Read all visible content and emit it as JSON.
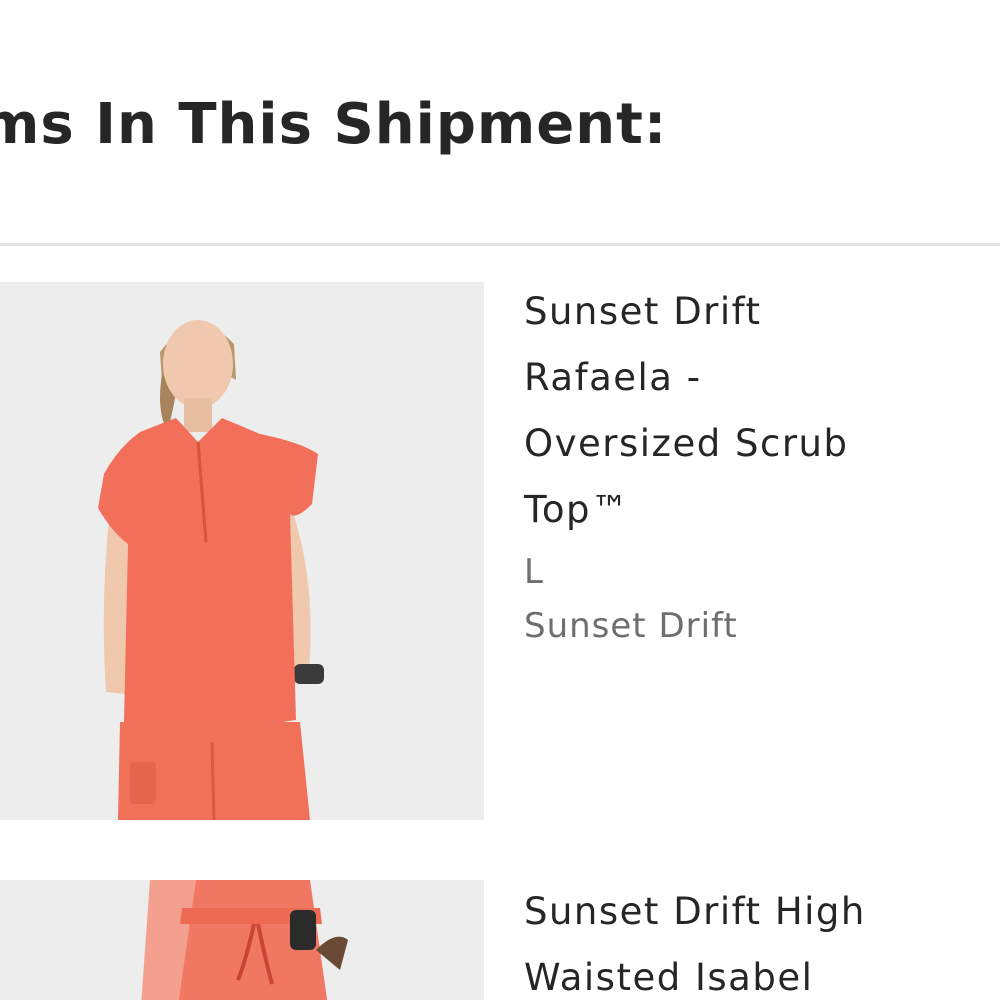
{
  "shipment": {
    "heading": "ems In This Shipment:",
    "items": [
      {
        "title_lines": [
          "Sunset Drift",
          "Rafaela -",
          "Oversized Scrub",
          "Top™"
        ],
        "size": "L",
        "color": "Sunset Drift",
        "image_icon": "product-photo-scrub-top"
      },
      {
        "title_lines": [
          "Sunset Drift High",
          "Waisted Isabel"
        ],
        "image_icon": "product-photo-scrub-pants"
      }
    ]
  },
  "colors": {
    "product_coral": "#f26f5a",
    "image_background": "#ededed",
    "heading_text": "#262626",
    "meta_text": "#6e6e6e"
  }
}
